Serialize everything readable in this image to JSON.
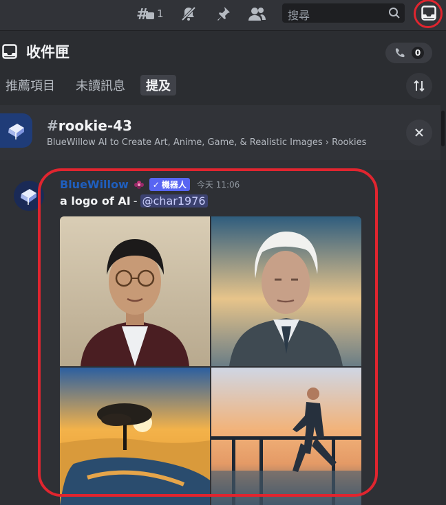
{
  "topbar": {
    "thread_count": "1",
    "search_placeholder": "搜尋",
    "icons": [
      "threads-icon",
      "notification-off-icon",
      "pin-icon",
      "members-icon",
      "search-icon",
      "inbox-icon"
    ]
  },
  "inbox": {
    "title": "收件匣",
    "mention_count": "0",
    "tabs": [
      {
        "label": "推薦項目",
        "active": false
      },
      {
        "label": "未讀訊息",
        "active": false
      },
      {
        "label": "提及",
        "active": true
      }
    ]
  },
  "channel": {
    "name": "rookie-43",
    "path": "BlueWillow AI to Create Art, Anime, Game, & Realistic Images › Rookies"
  },
  "message": {
    "author": "BlueWillow",
    "bot_label": "機器人",
    "timestamp": "今天 11:06",
    "text": "a logo of AI",
    "separator": "-",
    "mention": "@char1976",
    "image_panels": [
      "portrait-man-glasses",
      "portrait-old-man-white-hair",
      "tree-sunset-lake",
      "man-walking-pier"
    ]
  },
  "colors": {
    "accent_blue": "#5865f2",
    "highlight_red": "#e0252f",
    "author_color": "#1f5fbf"
  }
}
